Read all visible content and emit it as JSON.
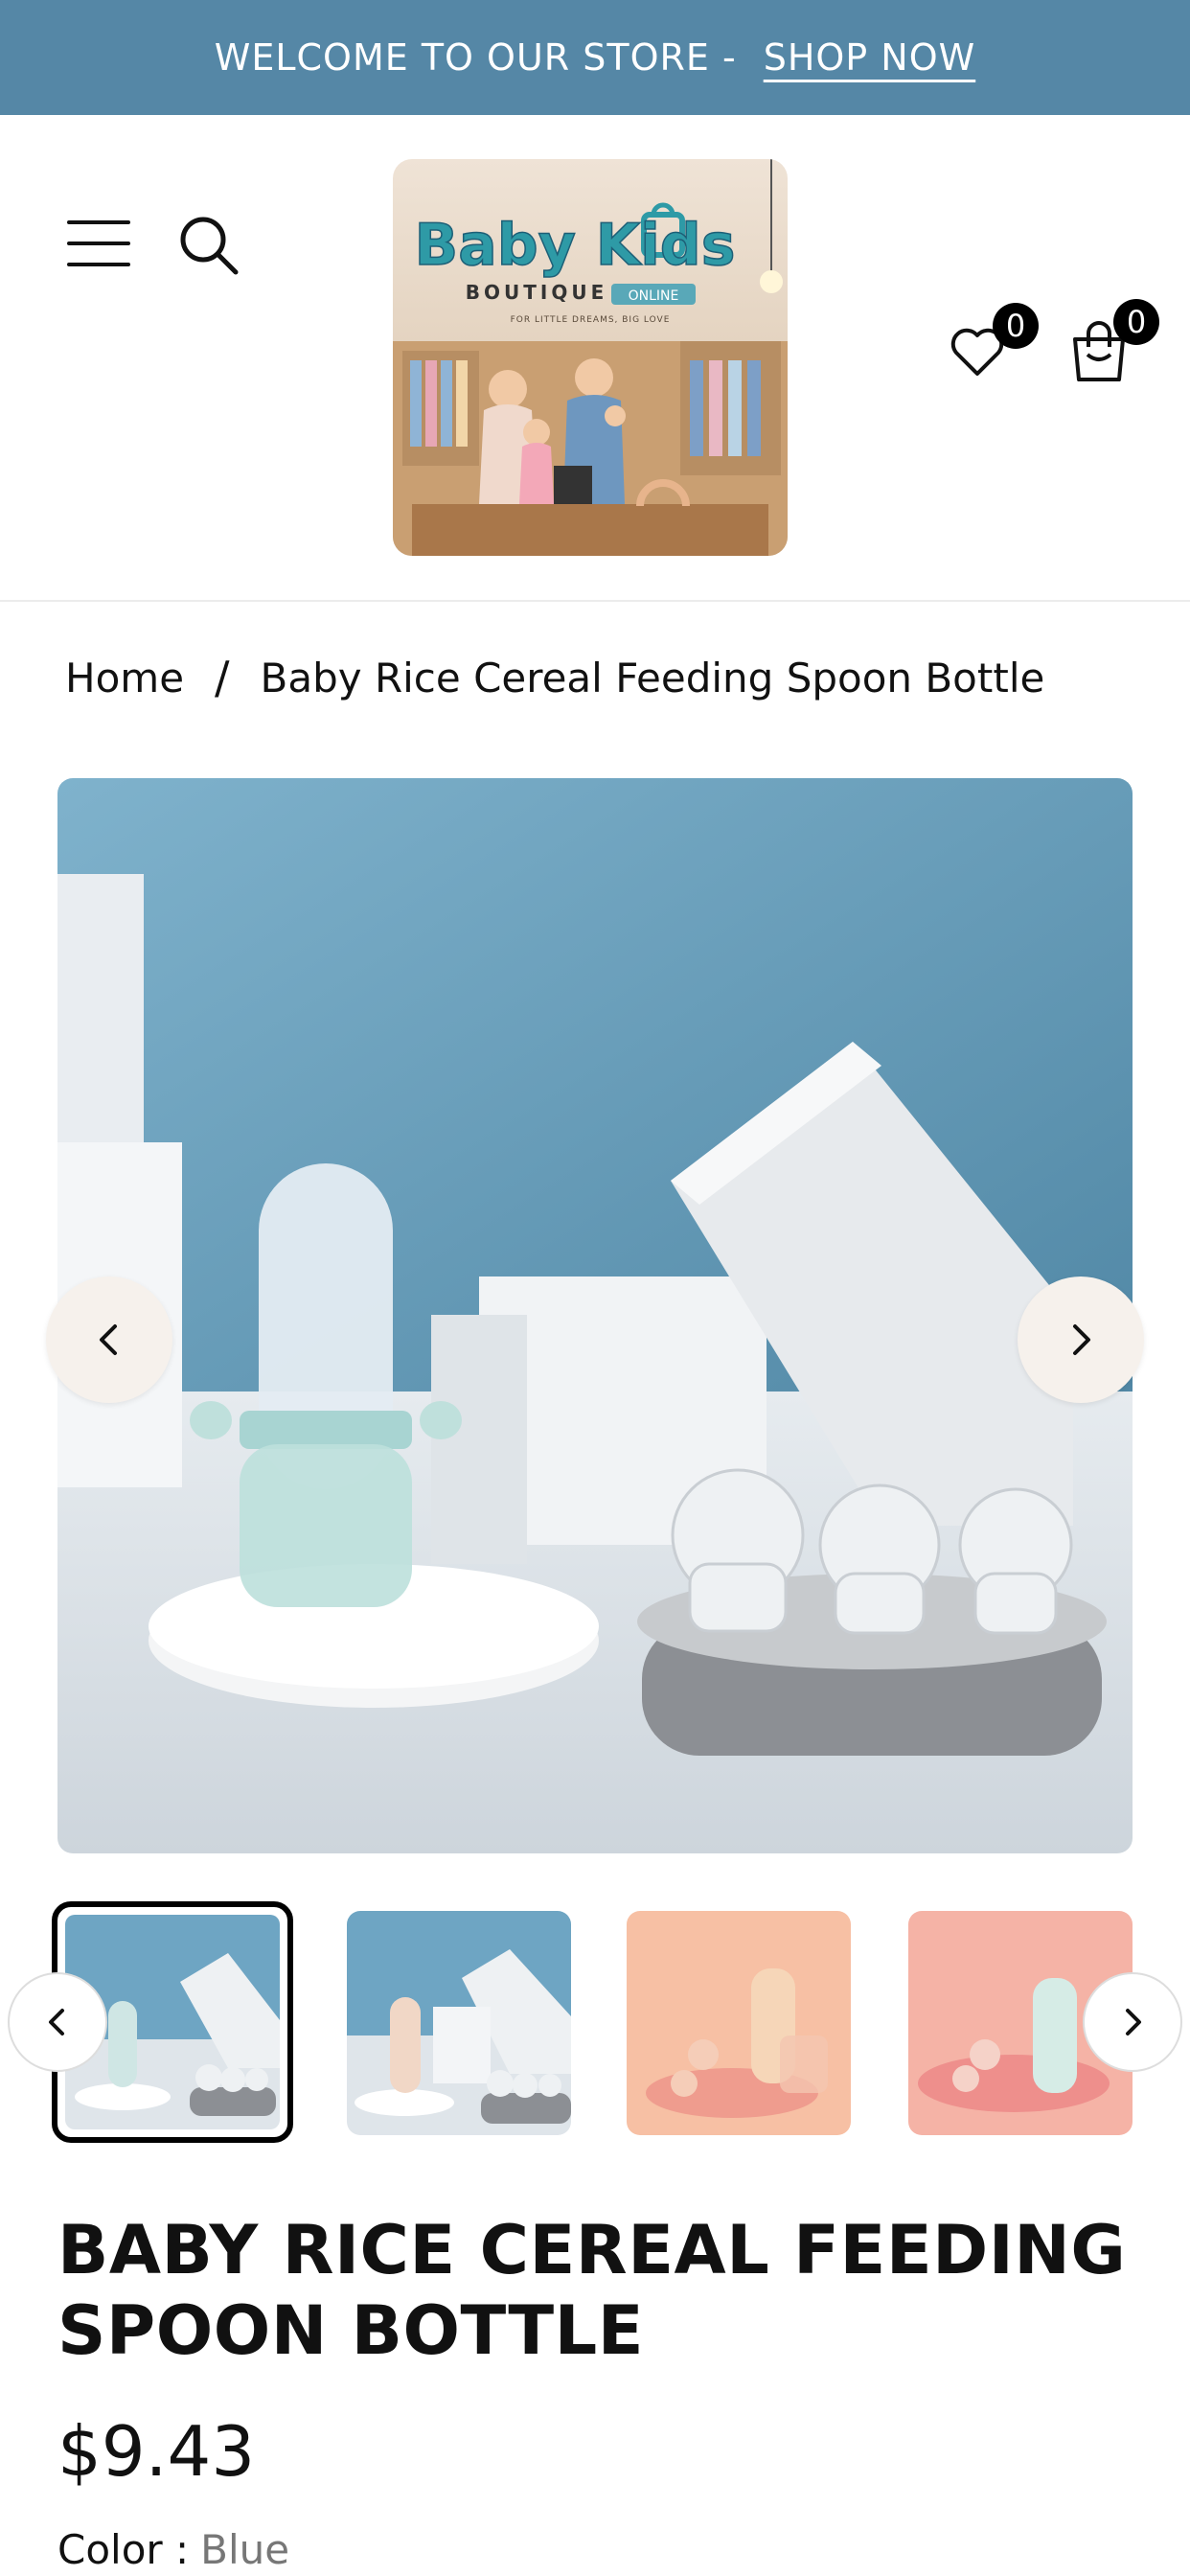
{
  "announcement": {
    "text": "WELCOME TO OUR STORE -",
    "link": "SHOP NOW"
  },
  "header": {
    "logo": {
      "brand": "Baby Kids",
      "sub": "BOUTIQUE",
      "badge": "ONLINE",
      "tagline": "FOR LITTLE DREAMS, BIG LOVE"
    },
    "wishlist_count": "0",
    "cart_count": "0",
    "icons": [
      "menu-icon",
      "search-icon",
      "heart-icon",
      "shopping-bag-icon"
    ]
  },
  "breadcrumb": {
    "home": "Home",
    "separator": "/",
    "current": "Baby Rice Cereal Feeding Spoon Bottle"
  },
  "product": {
    "title": "BABY RICE CEREAL FEEDING SPOON BOTTLE",
    "price": "$9.43",
    "color_label": "Color :",
    "color_value": "Blue"
  },
  "colors": {
    "announcement_bg": "#5587a6",
    "nav_button_bg": "#f6f1ec"
  }
}
